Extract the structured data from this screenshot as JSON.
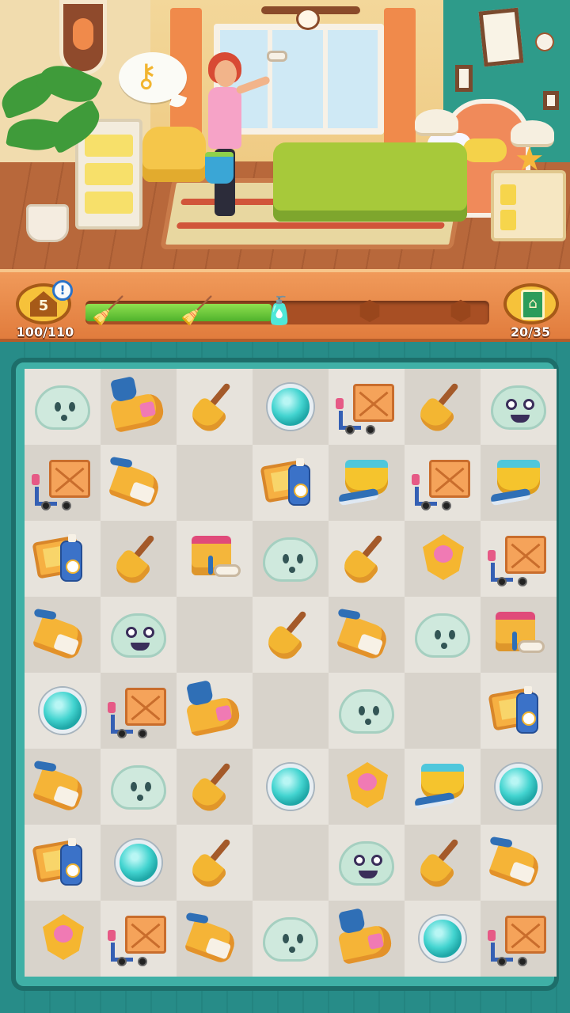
{
  "hud": {
    "level": "5",
    "level_alert": "!",
    "xp_text": "100/110",
    "progress_fraction": 0.46,
    "tasks_text": "20/35",
    "milestones": [
      {
        "icon": "dustpan-icon",
        "state": "done"
      },
      {
        "icon": "broom-icon",
        "state": "done"
      },
      {
        "icon": "spray-bottle-icon",
        "state": "current"
      },
      {
        "icon": "locked-reward-icon",
        "state": "locked"
      },
      {
        "icon": "locked-reward-icon",
        "state": "locked"
      }
    ]
  },
  "board": {
    "rows": 8,
    "cols": 7,
    "cells": [
      [
        "ghost",
        "roll",
        "broom",
        "gem",
        "crate",
        "broom",
        "monster"
      ],
      [
        "crate",
        "pan",
        "",
        "spray",
        "tub",
        "crate",
        "tub"
      ],
      [
        "spray",
        "broom",
        "can",
        "ghost",
        "broom",
        "amulet",
        "crate"
      ],
      [
        "pan",
        "monster",
        "",
        "broom",
        "pan",
        "ghost",
        "can"
      ],
      [
        "gem",
        "crate",
        "roll",
        "",
        "ghost",
        "",
        "spray"
      ],
      [
        "pan",
        "ghost",
        "broom",
        "gem",
        "amulet",
        "tub",
        "gem"
      ],
      [
        "spray",
        "gem",
        "broom",
        "",
        "monster",
        "broom",
        "pan"
      ],
      [
        "amulet",
        "crate",
        "pan",
        "ghost",
        "roll",
        "gem",
        "crate"
      ]
    ]
  },
  "colors": {
    "board_bg": "#3fb0a6",
    "cell_light": "#e7e3dc",
    "cell_dark": "#d8d3cb",
    "progress_fill": "#4fb22c",
    "hud_bar": "#e17c3d"
  }
}
